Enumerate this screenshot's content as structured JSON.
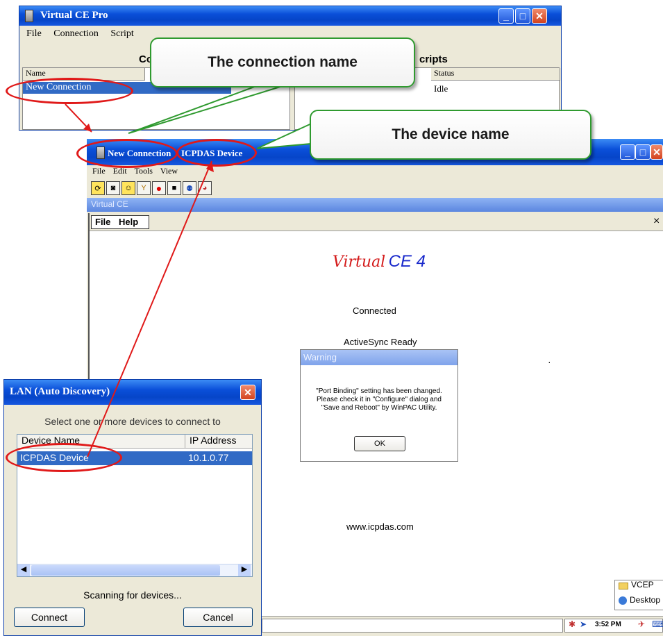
{
  "main_window": {
    "title": "Virtual CE Pro",
    "menu": [
      "File",
      "Connection",
      "Script"
    ],
    "connections_header": "Conn",
    "scripts_header": "cripts",
    "col_name": "Name",
    "col_status": "Status",
    "row_name": "New Connection",
    "row_status": "Idle"
  },
  "callouts": {
    "connection": "The connection name",
    "device": "The device name"
  },
  "device_window": {
    "title_connection": "New Connection",
    "title_device": "ICPDAS Device",
    "menu": [
      "File",
      "Edit",
      "Tools",
      "View"
    ],
    "subtitle": "Virtual CE",
    "inner_menu": [
      "File",
      "Help"
    ],
    "inner_close": "×",
    "logo_part1": "Virtual",
    "logo_part2": "CE 4",
    "status_connected": "Connected",
    "status_activesync": "ActiveSync Ready",
    "website": "www.icpdas.com",
    "warning_title": "Warning",
    "warning_message": "\"Port Binding\" setting has been changed. Please check it in \"Configure\" dialog and  \"Save and Reboot\" by WinPAC Utility.",
    "warning_ok": "OK",
    "desktop_items": [
      "VCEP",
      "Desktop"
    ],
    "clock": "3:52 PM"
  },
  "lan_dialog": {
    "title": "LAN (Auto Discovery)",
    "instruction": "Select one or more devices to connect to",
    "col_device": "Device Name",
    "col_ip": "IP Address",
    "device_name": "ICPDAS Device",
    "device_ip": "10.1.0.77",
    "status": "Scanning for devices...",
    "connect": "Connect",
    "cancel": "Cancel"
  },
  "colors": {
    "highlight": "#316ac5",
    "annotation_red": "#e01919",
    "callout_border": "#2f9a2f"
  }
}
